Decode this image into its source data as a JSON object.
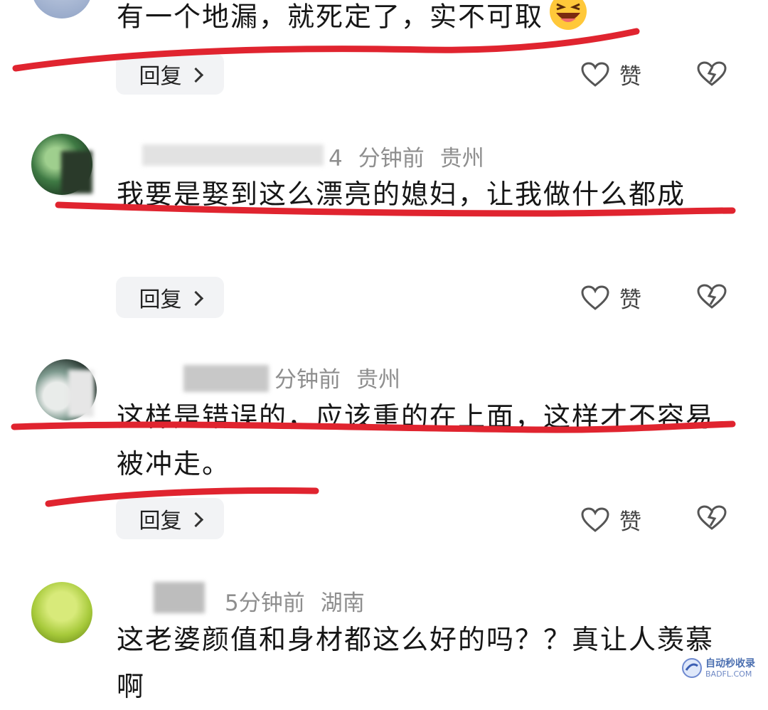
{
  "comments": [
    {
      "text": "有一个地漏，就死定了，实不可取",
      "emoji": "laughing-emoji",
      "reply_label": "回复",
      "like_label": "赞"
    },
    {
      "time": "分钟前",
      "location": "贵州",
      "text": "我要是娶到这么漂亮的媳妇，让我做什么都成",
      "reply_label": "回复",
      "like_label": "赞"
    },
    {
      "time": "分钟前",
      "location": "贵州",
      "text": "这样是错误的，应该重的在上面，这样才不容易被冲走。",
      "reply_label": "回复",
      "like_label": "赞"
    },
    {
      "time": "5分钟前",
      "location": "湖南",
      "text": "这老婆颜值和身材都这么好的吗？？真让人羡慕啊"
    }
  ],
  "watermark": {
    "title": "自动秒收录",
    "url": "BADFL.COM"
  },
  "colors": {
    "underline": "#e0242f",
    "meta": "#8e8e8e",
    "reply_bg": "#f2f3f5"
  }
}
